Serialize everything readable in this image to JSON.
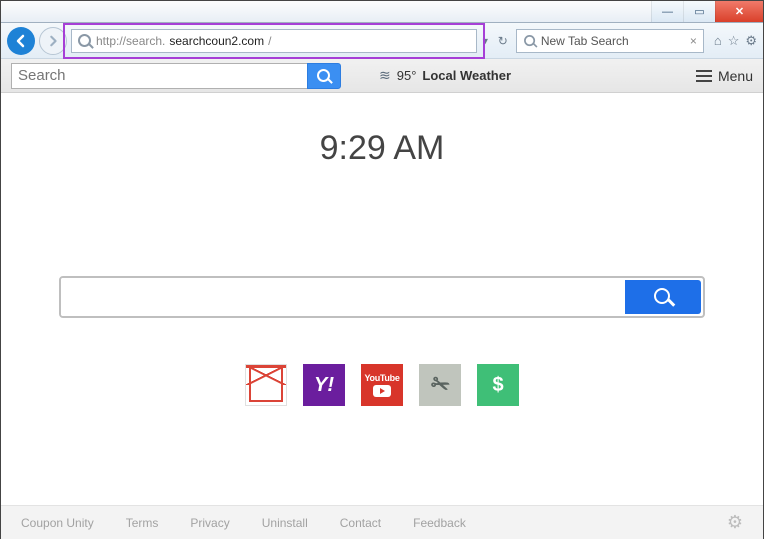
{
  "window": {
    "min": "—",
    "max": "▭",
    "close": "✕"
  },
  "ie": {
    "url_prefix": "http://search.",
    "url_domain": "searchcoun2.com",
    "url_suffix": "/",
    "tab_title": "New Tab Search",
    "tab_close": "×"
  },
  "toolbar": {
    "search_placeholder": "Search",
    "weather_temp": "95°",
    "weather_label": "Local Weather",
    "menu_label": "Menu"
  },
  "clock": "9:29 AM",
  "tiles": {
    "yahoo": "Y!",
    "youtube_label": "YouTube",
    "dollar": "$"
  },
  "footer": {
    "links": [
      "Coupon Unity",
      "Terms",
      "Privacy",
      "Uninstall",
      "Contact",
      "Feedback"
    ]
  }
}
